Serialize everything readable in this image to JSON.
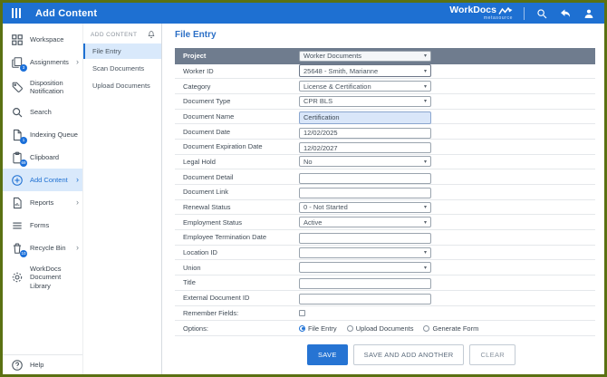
{
  "header": {
    "title": "Add Content",
    "brand": {
      "name": "WorkDocs",
      "sub": "metasource"
    },
    "accent_color": "#1e70d2"
  },
  "sidebar": {
    "items": [
      {
        "label": "Workspace",
        "icon": "workspace-icon"
      },
      {
        "label": "Assignments",
        "icon": "assignments-icon",
        "badge": "3",
        "chevron": "›"
      },
      {
        "label": "Disposition Notification",
        "icon": "tag-icon"
      },
      {
        "label": "Search",
        "icon": "search-icon"
      },
      {
        "label": "Indexing Queue",
        "icon": "indexing-queue-icon",
        "badge": "1"
      },
      {
        "label": "Clipboard",
        "icon": "clipboard-icon",
        "badge": "69"
      },
      {
        "label": "Add Content",
        "icon": "add-content-icon",
        "chevron": "›",
        "selected": true
      },
      {
        "label": "Reports",
        "icon": "reports-icon",
        "chevron": "›"
      },
      {
        "label": "Forms",
        "icon": "forms-icon"
      },
      {
        "label": "Recycle Bin",
        "icon": "recycle-bin-icon",
        "badge": "10",
        "chevron": "›"
      },
      {
        "label": "WorkDocs Document Library",
        "icon": "library-icon"
      }
    ],
    "help_label": "Help"
  },
  "submenu": {
    "title": "ADD CONTENT",
    "items": [
      {
        "label": "File Entry",
        "selected": true
      },
      {
        "label": "Scan Documents"
      },
      {
        "label": "Upload Documents"
      }
    ]
  },
  "form": {
    "title": "File Entry",
    "rows": [
      {
        "label": "Project",
        "type": "select",
        "value": "Worker Documents"
      },
      {
        "label": "Worker ID",
        "type": "select",
        "value": "25648 - Smith, Marianne"
      },
      {
        "label": "Category",
        "type": "select",
        "value": "License & Certification"
      },
      {
        "label": "Document Type",
        "type": "select",
        "value": "CPR BLS"
      },
      {
        "label": "Document Name",
        "type": "input",
        "value": "Certification"
      },
      {
        "label": "Document Date",
        "type": "input",
        "value": "12/02/2025"
      },
      {
        "label": "Document Expiration Date",
        "type": "input",
        "value": "12/02/2027"
      },
      {
        "label": "Legal Hold",
        "type": "select",
        "value": "No"
      },
      {
        "label": "Document Detail",
        "type": "input",
        "value": ""
      },
      {
        "label": "Document Link",
        "type": "input",
        "value": ""
      },
      {
        "label": "Renewal Status",
        "type": "select",
        "value": "0 - Not Started"
      },
      {
        "label": "Employment Status",
        "type": "select",
        "value": "Active"
      },
      {
        "label": "Employee Termination Date",
        "type": "input",
        "value": ""
      },
      {
        "label": "Location ID",
        "type": "select",
        "value": ""
      },
      {
        "label": "Union",
        "type": "select",
        "value": ""
      },
      {
        "label": "Title",
        "type": "input",
        "value": ""
      },
      {
        "label": "External Document ID",
        "type": "input",
        "value": ""
      }
    ],
    "remember_label": "Remember Fields:",
    "options_label": "Options:",
    "options": [
      {
        "label": "File Entry",
        "selected": true
      },
      {
        "label": "Upload Documents",
        "selected": false
      },
      {
        "label": "Generate Form",
        "selected": false
      }
    ],
    "buttons": {
      "save": "SAVE",
      "save_add": "SAVE AND ADD ANOTHER",
      "clear": "CLEAR"
    }
  }
}
